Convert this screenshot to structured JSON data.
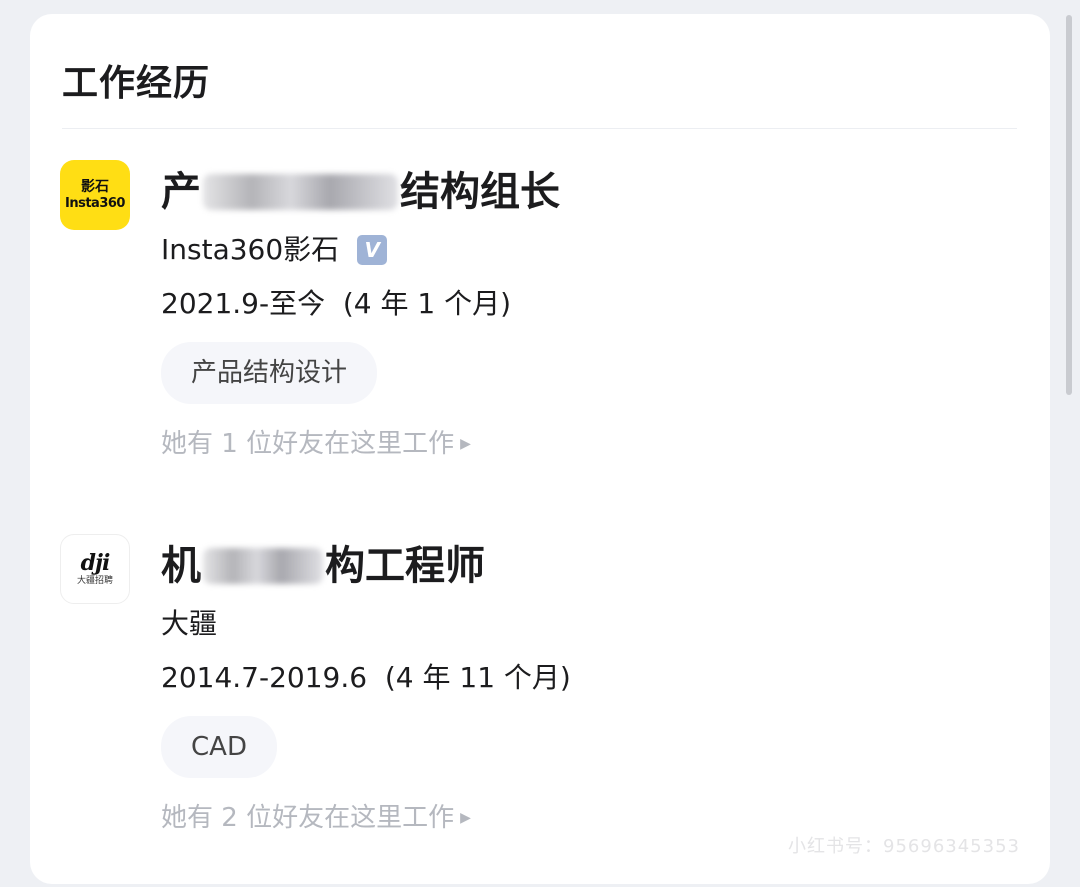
{
  "section": {
    "title": "工作经历"
  },
  "experiences": [
    {
      "logo_line1": "影石",
      "logo_line2": "Insta360",
      "title_prefix": "产",
      "title_suffix": "结构组长",
      "company": "Insta360影石",
      "verified_label": "V",
      "period": "2021.9-至今  (4 年 1 个月)",
      "tag": "产品结构设计",
      "friends": "她有 1 位好友在这里工作"
    },
    {
      "logo_line1": "dji",
      "logo_line2": "大疆招聘",
      "title_prefix": "机",
      "title_suffix": "构工程师",
      "company": "大疆",
      "period": "2014.7-2019.6  (4 年 11 个月)",
      "tag": "CAD",
      "friends": "她有 2 位好友在这里工作"
    }
  ],
  "watermark": "小红书号：95696345353"
}
